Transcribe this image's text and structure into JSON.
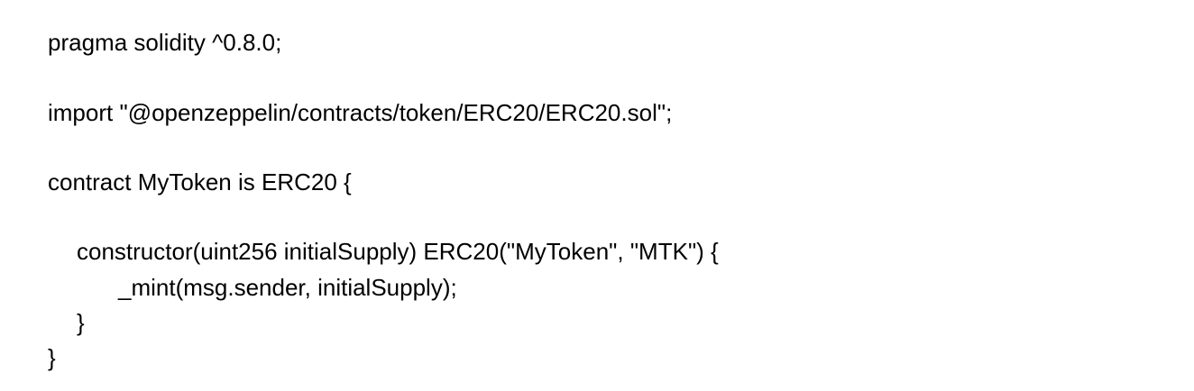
{
  "document": {
    "lines": [
      "pragma solidity ^0.8.0;",
      "import \"@openzeppelin/contracts/token/ERC20/ERC20.sol\";",
      "contract MyToken is ERC20 {",
      "constructor(uint256 initialSupply) ERC20(\"MyToken\", \"MTK\") {",
      "_mint(msg.sender, initialSupply);",
      "}",
      "}"
    ]
  }
}
